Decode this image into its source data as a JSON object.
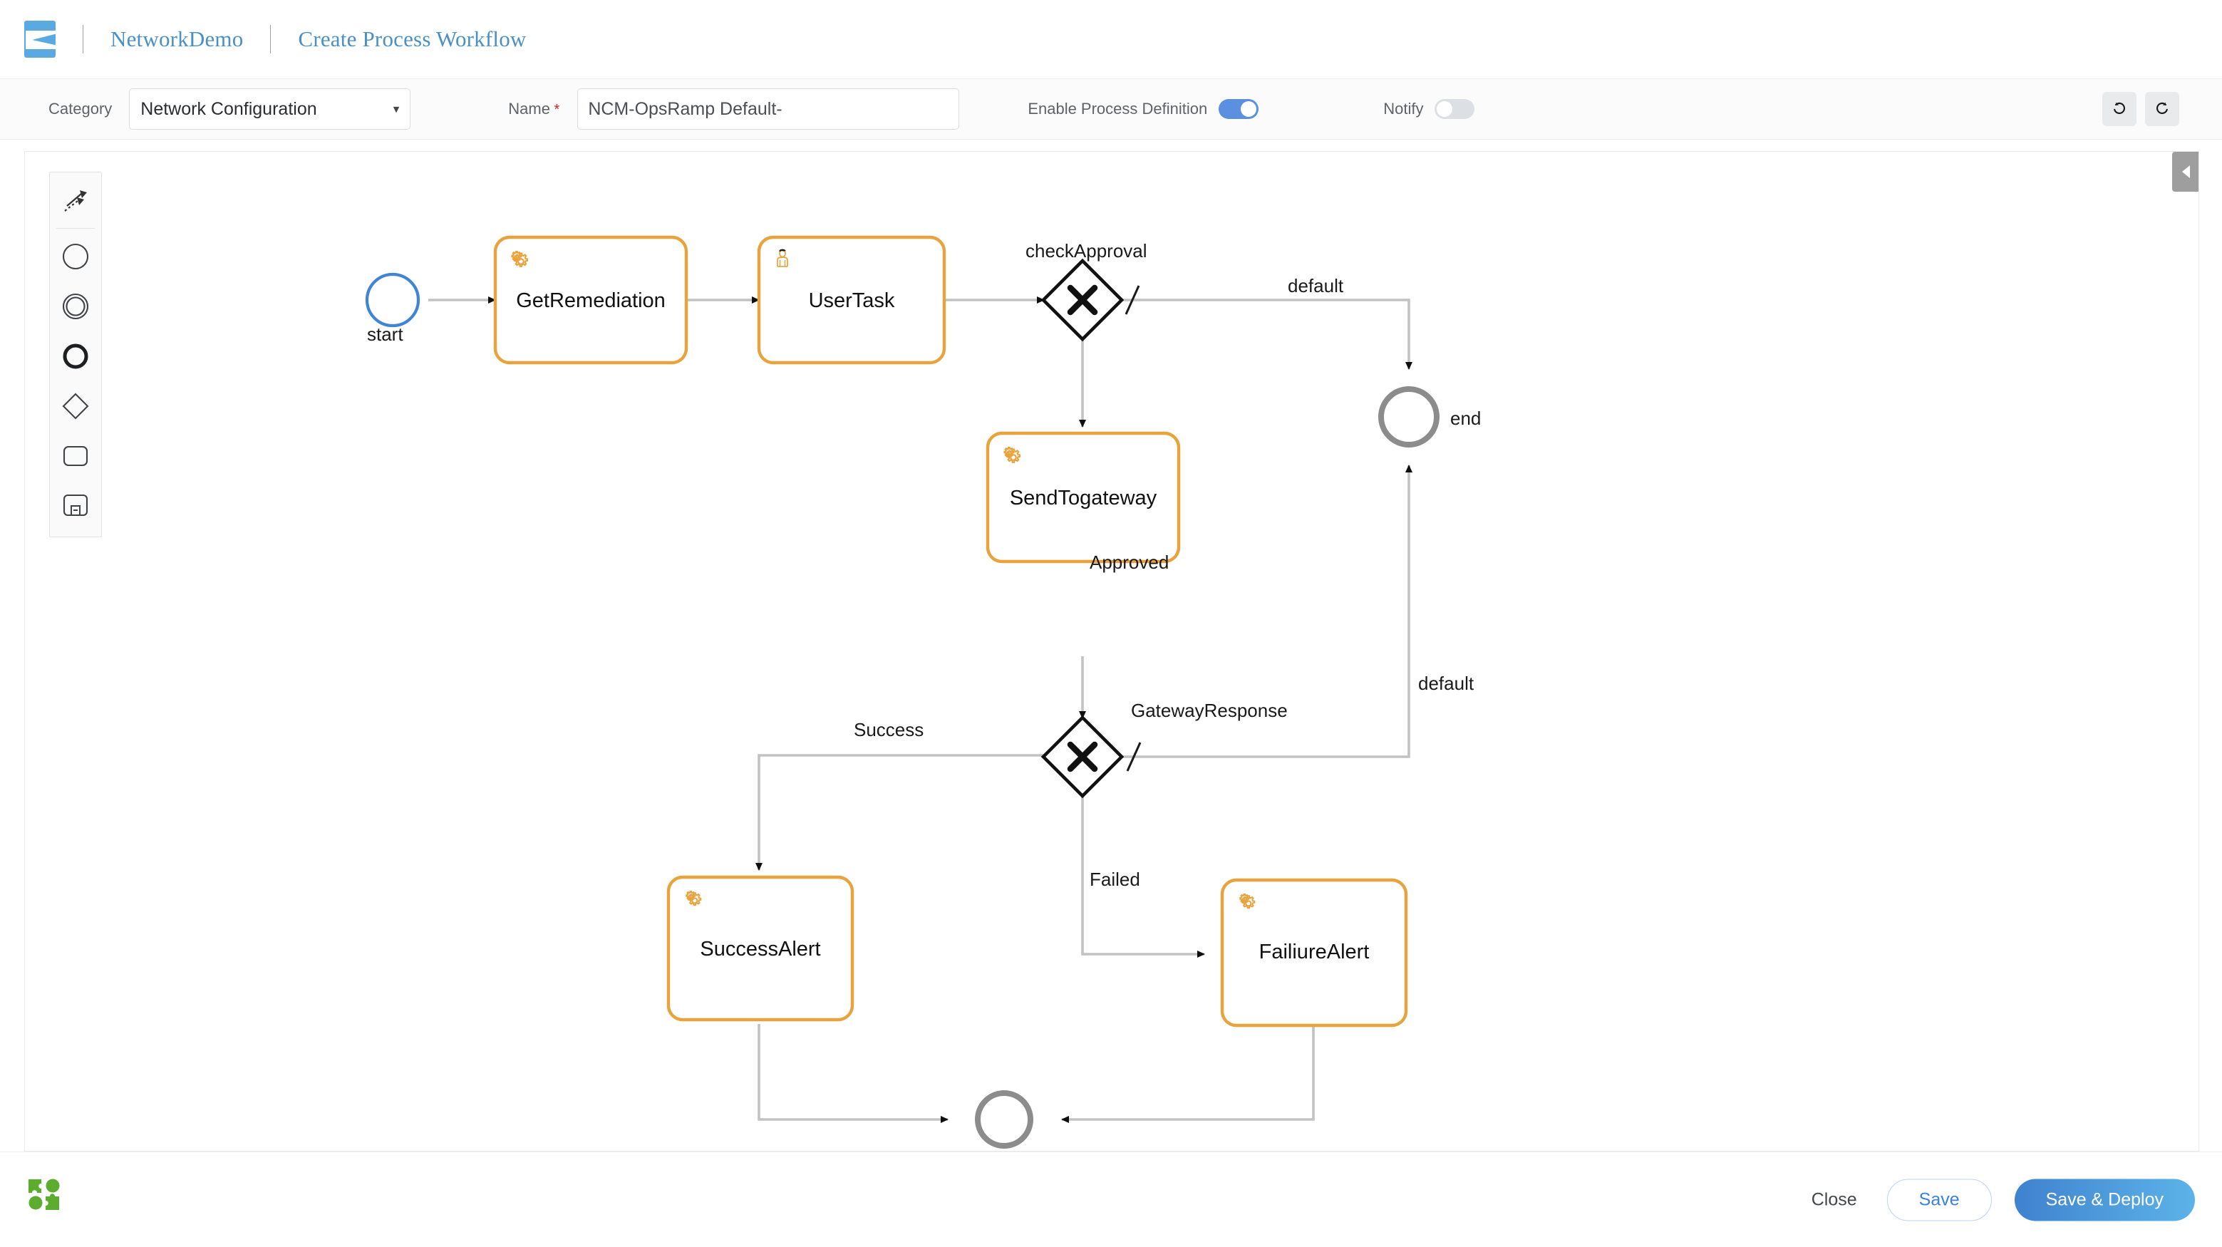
{
  "header": {
    "logo_icon": "brand-logo-icon",
    "breadcrumb_project": "NetworkDemo",
    "breadcrumb_page": "Create Process Workflow"
  },
  "toolbar": {
    "category_label": "Category",
    "category_value": "Network Configuration",
    "category_options": [
      "Network Configuration"
    ],
    "name_label": "Name",
    "name_value": "NCM-OpsRamp Default-",
    "name_placeholder": "Name",
    "enable_process_definition_label": "Enable Process Definition",
    "enable_process_definition_state": "on",
    "notify_label": "Notify",
    "notify_state": "off",
    "undo_icon": "undo-icon",
    "redo_icon": "redo-icon"
  },
  "palette": {
    "items": [
      {
        "icon": "lasso-tool-icon",
        "name": "activate-hand-tool"
      },
      {
        "icon": "start-event-circle-icon",
        "name": "create-start-event"
      },
      {
        "icon": "intermediate-event-double-circle-icon",
        "name": "create-intermediate-event"
      },
      {
        "icon": "end-event-thick-circle-icon",
        "name": "create-end-event"
      },
      {
        "icon": "gateway-diamond-icon",
        "name": "create-gateway"
      },
      {
        "icon": "task-rounded-rect-icon",
        "name": "create-task"
      },
      {
        "icon": "subprocess-expanded-icon",
        "name": "create-subprocess"
      }
    ]
  },
  "canvas": {
    "collapse_handle_icon": "chevron-left-icon",
    "nodes": [
      {
        "id": "start",
        "type": "start-event",
        "label": "start",
        "label_pos": "below"
      },
      {
        "id": "GetRemediation",
        "type": "service-task",
        "label": "GetRemediation",
        "icon": "gear-icon"
      },
      {
        "id": "UserTask",
        "type": "user-task",
        "label": "UserTask",
        "icon": "user-icon"
      },
      {
        "id": "checkApproval",
        "type": "exclusive-gateway",
        "label": "checkApproval",
        "label_pos": "above"
      },
      {
        "id": "end",
        "type": "end-event",
        "label": "end",
        "label_pos": "right"
      },
      {
        "id": "SendTogateway",
        "type": "service-task",
        "label": "SendTogateway",
        "icon": "gear-icon"
      },
      {
        "id": "GatewayResponse",
        "type": "exclusive-gateway",
        "label": "GatewayResponse",
        "label_pos": "right"
      },
      {
        "id": "SuccessAlert",
        "type": "service-task",
        "label": "SuccessAlert",
        "icon": "gear-icon"
      },
      {
        "id": "FailiureAlert",
        "type": "service-task",
        "label": "FailiureAlert",
        "icon": "gear-icon"
      },
      {
        "id": "end2",
        "type": "end-event",
        "label": "",
        "label_pos": "none"
      }
    ],
    "flows": [
      {
        "from": "start",
        "to": "GetRemediation",
        "label": ""
      },
      {
        "from": "GetRemediation",
        "to": "UserTask",
        "label": ""
      },
      {
        "from": "UserTask",
        "to": "checkApproval",
        "label": ""
      },
      {
        "from": "checkApproval",
        "to": "end",
        "label": "default",
        "is_default": true
      },
      {
        "from": "checkApproval",
        "to": "SendTogateway",
        "label": "Approved"
      },
      {
        "from": "SendTogateway",
        "to": "GatewayResponse",
        "label": ""
      },
      {
        "from": "GatewayResponse",
        "to": "end",
        "label": "default",
        "is_default": true
      },
      {
        "from": "GatewayResponse",
        "to": "SuccessAlert",
        "label": "Success"
      },
      {
        "from": "GatewayResponse",
        "to": "FailiureAlert",
        "label": "Failed"
      },
      {
        "from": "SuccessAlert",
        "to": "end2",
        "label": ""
      },
      {
        "from": "FailiureAlert",
        "to": "end2",
        "label": ""
      }
    ]
  },
  "footer": {
    "logo_icon": "bpmn-puzzle-logo-icon",
    "close_label": "Close",
    "save_label": "Save",
    "deploy_label": "Save & Deploy"
  },
  "colors": {
    "brand_blue": "#5aa9e0",
    "link_blue": "#4a90c4",
    "task_orange": "#e8a33d",
    "start_blue": "#3f84d8",
    "end_gray": "#8c8c8c",
    "flow_gray": "#b8b8b8",
    "toggle_on": "#5b8fe0",
    "toggle_off": "#dcdfe3",
    "footer_green": "#5cad2f"
  }
}
